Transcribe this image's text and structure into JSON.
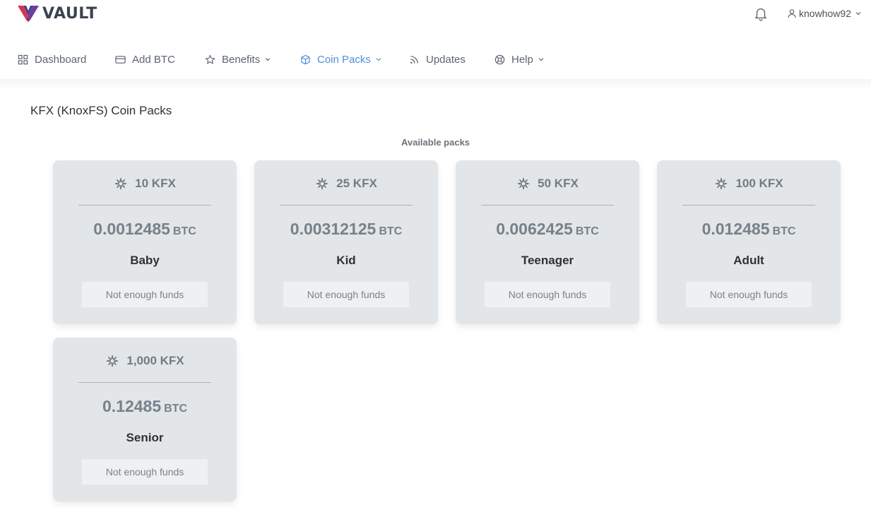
{
  "brand": {
    "name": "VAULT"
  },
  "header": {
    "username": "knowhow92"
  },
  "nav": {
    "items": [
      {
        "label": "Dashboard",
        "icon": "grid-icon"
      },
      {
        "label": "Add BTC",
        "icon": "card-icon"
      },
      {
        "label": "Benefits",
        "icon": "star-icon"
      },
      {
        "label": "Coin Packs",
        "icon": "box-icon",
        "active": true
      },
      {
        "label": "Updates",
        "icon": "rss-icon"
      },
      {
        "label": "Help",
        "icon": "lifebuoy-icon"
      }
    ]
  },
  "page": {
    "title": "KFX (KnoxFS) Coin Packs",
    "section": "Available packs"
  },
  "packs": [
    {
      "coins": "10 KFX",
      "price": "0.0012485",
      "currency": "BTC",
      "name": "Baby",
      "button": "Not enough funds"
    },
    {
      "coins": "25 KFX",
      "price": "0.00312125",
      "currency": "BTC",
      "name": "Kid",
      "button": "Not enough funds"
    },
    {
      "coins": "50 KFX",
      "price": "0.0062425",
      "currency": "BTC",
      "name": "Teenager",
      "button": "Not enough funds"
    },
    {
      "coins": "100 KFX",
      "price": "0.012485",
      "currency": "BTC",
      "name": "Adult",
      "button": "Not enough funds"
    },
    {
      "coins": "1,000 KFX",
      "price": "0.12485",
      "currency": "BTC",
      "name": "Senior",
      "button": "Not enough funds"
    }
  ],
  "colors": {
    "accent": "#4f8fd6",
    "card_bg": "#e2e6e8",
    "logo_red": "#d9344f",
    "logo_purple": "#6b3fa0"
  }
}
